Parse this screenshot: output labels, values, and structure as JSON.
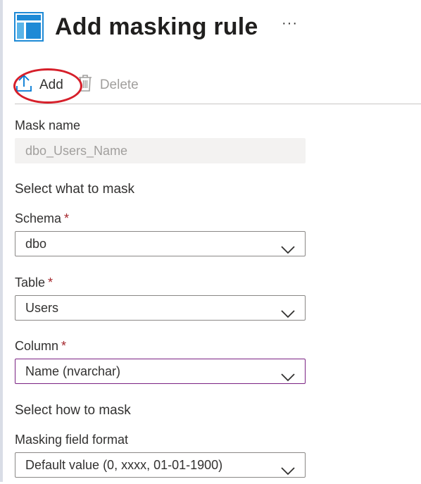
{
  "header": {
    "title": "Add masking rule",
    "more_label": "···",
    "icon": "masking-blade-icon"
  },
  "toolbar": {
    "add_label": "Add",
    "delete_label": "Delete",
    "annotation_color": "#d61f2a"
  },
  "form": {
    "mask_name": {
      "label": "Mask name",
      "value": "dbo_Users_Name"
    },
    "section_what": "Select what to mask",
    "schema": {
      "label": "Schema",
      "required": "*",
      "value": "dbo"
    },
    "table": {
      "label": "Table",
      "required": "*",
      "value": "Users"
    },
    "column": {
      "label": "Column",
      "required": "*",
      "value": "Name (nvarchar)"
    },
    "section_how": "Select how to mask",
    "format": {
      "label": "Masking field format",
      "value": "Default value (0, xxxx, 01-01-1900)"
    }
  },
  "colors": {
    "accent": "#0078d4",
    "required": "#a4262c",
    "focus_border": "#7a2283"
  }
}
